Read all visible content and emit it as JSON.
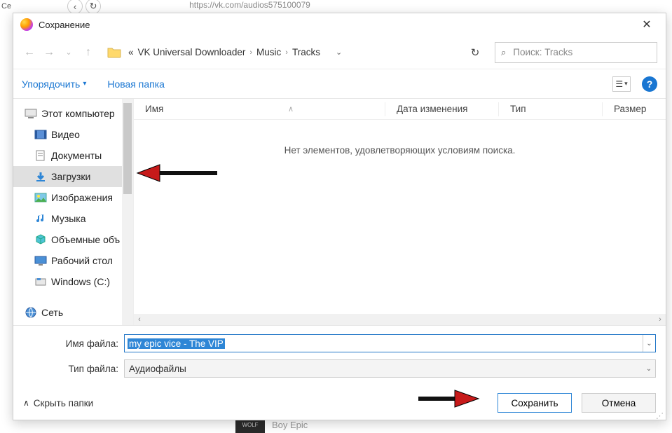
{
  "browser": {
    "left_tab": "Се",
    "url_fragment": "https://vk.com/audios575100079",
    "bg_artist": "Boy Epic",
    "bg_thumb": "WOLF"
  },
  "dialog": {
    "title": "Сохранение",
    "close": "✕"
  },
  "nav": {
    "back": "←",
    "fwd": "→",
    "dd": "⌄",
    "up": "↑",
    "pre": "«",
    "crumbs": [
      "VK Universal Downloader",
      "Music",
      "Tracks"
    ],
    "sep": "›",
    "dropdown": "⌄",
    "refresh": "↻",
    "search_icon": "🔍",
    "search_placeholder": "Поиск: Tracks"
  },
  "toolbar": {
    "organize": "Упорядочить",
    "organize_dd": "▾",
    "newfolder": "Новая папка",
    "view_dd": "▾",
    "help": "?"
  },
  "tree": [
    {
      "label": "Этот компьютер",
      "icon": "pc",
      "root": true
    },
    {
      "label": "Видео",
      "icon": "video"
    },
    {
      "label": "Документы",
      "icon": "docs"
    },
    {
      "label": "Загрузки",
      "icon": "down",
      "selected": true
    },
    {
      "label": "Изображения",
      "icon": "img"
    },
    {
      "label": "Музыка",
      "icon": "music"
    },
    {
      "label": "Объемные объ",
      "icon": "cube"
    },
    {
      "label": "Рабочий стол",
      "icon": "desk"
    },
    {
      "label": "Windows (C:)",
      "icon": "disk"
    },
    {
      "label": "Сеть",
      "icon": "net",
      "root": true,
      "gap": true
    }
  ],
  "columns": {
    "name": "Имя",
    "sort": "∧",
    "date": "Дата изменения",
    "type": "Тип",
    "size": "Размер"
  },
  "empty_msg": "Нет элементов, удовлетворяющих условиям поиска.",
  "form": {
    "filename_label": "Имя файла:",
    "filename_value": "my epic vice - The VIP",
    "filetype_label": "Тип файла:",
    "filetype_value": "Аудиофайлы"
  },
  "footer": {
    "hide": "Скрыть папки",
    "hide_caret": "∧",
    "save": "Сохранить",
    "cancel": "Отмена"
  }
}
